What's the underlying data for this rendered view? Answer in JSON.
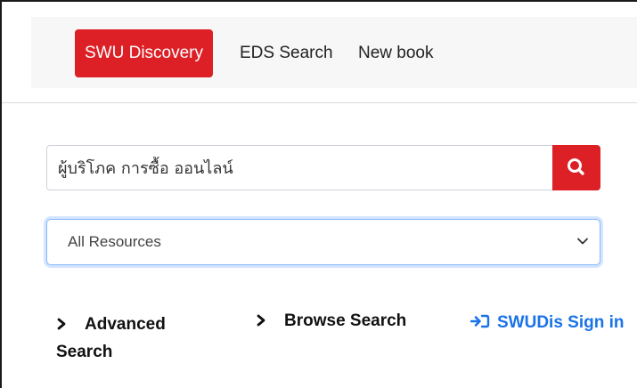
{
  "nav": {
    "tabs": [
      {
        "label": "SWU Discovery",
        "active": true
      },
      {
        "label": "EDS Search",
        "active": false
      },
      {
        "label": "New book",
        "active": false
      }
    ]
  },
  "search": {
    "value": "ผู้บริโภค การซื้อ ออนไลน์",
    "button_icon": "search-icon"
  },
  "resource_select": {
    "selected": "All Resources"
  },
  "links": {
    "advanced_search": "Advanced Search",
    "browse_search": "Browse Search",
    "sign_in": "SWUDis Sign in"
  },
  "colors": {
    "accent": "#dc2026",
    "link": "#1a73e8"
  }
}
